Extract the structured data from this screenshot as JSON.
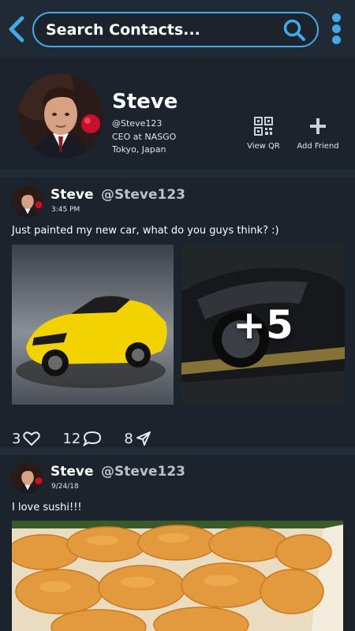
{
  "search": {
    "placeholder": "Search Contacts..."
  },
  "icons": {
    "back": "chevron-left-icon",
    "search": "magnifier-icon",
    "menu": "vertical-dots-icon",
    "qr": "qr-code-icon",
    "add": "plus-icon",
    "like": "heart-icon",
    "comment": "chat-bubble-icon",
    "share": "paper-plane-icon"
  },
  "profile": {
    "name": "Steve",
    "handle": "@Steve123",
    "title": "CEO at NASGO",
    "location": "Tokyo, Japan",
    "actions": {
      "view_qr": "View QR",
      "add_friend": "Add Friend"
    }
  },
  "posts": [
    {
      "name": "Steve",
      "handle": "@Steve123",
      "time": "3:45 PM",
      "text": "Just painted my new car, what do you guys think?  :)",
      "extra_photos": "+5",
      "likes": "3",
      "comments": "12",
      "shares": "8"
    },
    {
      "name": "Steve",
      "handle": "@Steve123",
      "time": "9/24/18",
      "text": "I love sushi!!!"
    }
  ],
  "colors": {
    "accent": "#46a8e6",
    "background": "#1b232d",
    "topbar": "#202a35"
  }
}
